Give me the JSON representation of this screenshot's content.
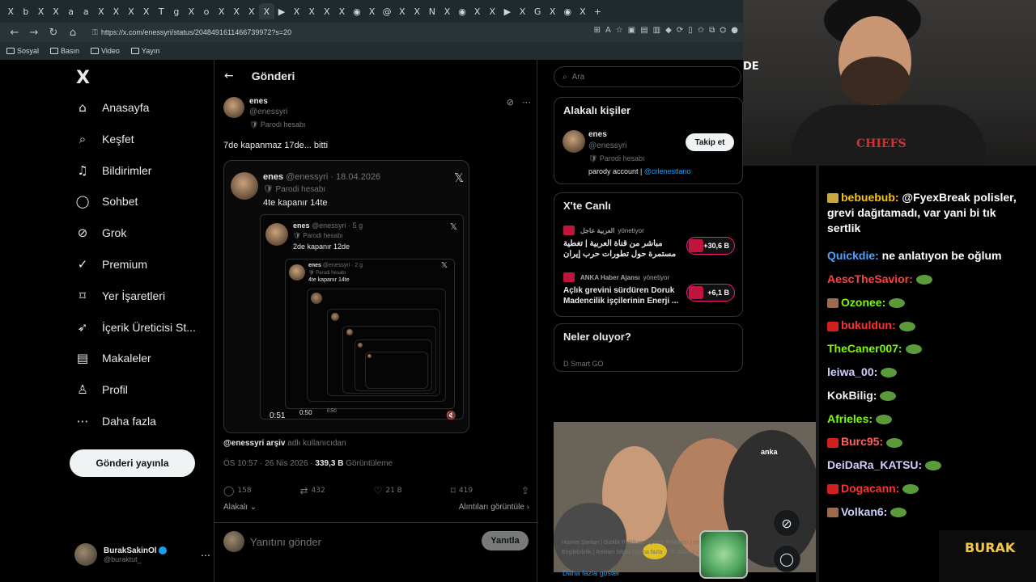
{
  "browser": {
    "tabs": [
      "X",
      "b",
      "X",
      "X",
      "a",
      "a",
      "X",
      "X",
      "X",
      "X",
      "T",
      "g",
      "X",
      "o",
      "X",
      "X",
      "X",
      "X",
      "▶",
      "X",
      "X",
      "X",
      "X",
      "◉",
      "X",
      "@",
      "X",
      "X",
      "N",
      "X",
      "◉",
      "X",
      "X",
      "▶",
      "X",
      "G",
      "X",
      "◉",
      "X",
      "+"
    ],
    "url": "https://x.com/enessyri/status/2048491611466739972?s=20",
    "bookmarks": [
      "Sosyal",
      "Basın",
      "Video",
      "Yayın"
    ]
  },
  "nav": {
    "logo": "X",
    "items": [
      {
        "label": "Anasayfa",
        "icon": "⌂"
      },
      {
        "label": "Keşfet",
        "icon": "⌕"
      },
      {
        "label": "Bildirimler",
        "icon": "♫"
      },
      {
        "label": "Sohbet",
        "icon": "◯"
      },
      {
        "label": "Grok",
        "icon": "⊘"
      },
      {
        "label": "Premium",
        "icon": "✓"
      },
      {
        "label": "Yer İşaretleri",
        "icon": "⌑"
      },
      {
        "label": "İçerik Üreticisi St...",
        "icon": "➶"
      },
      {
        "label": "Makaleler",
        "icon": "▤"
      },
      {
        "label": "Profil",
        "icon": "♙"
      },
      {
        "label": "Daha fazla",
        "icon": "⋯"
      }
    ],
    "post_button": "Gönderi yayınla",
    "account": {
      "name": "BurakSakinOl",
      "handle": "@buraktut_",
      "more": "⋯"
    }
  },
  "post": {
    "header_title": "Gönderi",
    "author": "enes",
    "handle": "@enessyri",
    "parody": "🛡 Parodi hesabı",
    "text": "7de kapanmaz 17de... bitti",
    "embed": {
      "author": "enes",
      "handle_date": "@enessyri · 18.04.2026",
      "parody": "🛡 Parodi hesabı",
      "text": "4te kapanır 14te",
      "nested_author": "enes",
      "nested_meta": "@enessyri · 5 g",
      "nested_parody": "🛡 Parodi hesabı",
      "nested_text": "2de kapanır 12de",
      "deep_author": "enes",
      "deep_meta": "@enessyri · 2 g",
      "deep_parody": "🛡 Parodi hesabı",
      "deep_text": "4te kapanır 14te",
      "time_outer": "0:51",
      "time_inner": "0:50",
      "time_inner2": "0:50"
    },
    "by_user": "@enessyri arşiv",
    "by_suffix": " adlı kullanıcıdan",
    "meta_time": "ÖS 10:57 · 26 Nis 2026 · ",
    "meta_views": "339,3 B",
    "meta_views_label": " Görüntüleme",
    "stats": {
      "replies": "158",
      "reposts": "432",
      "likes": "21 B",
      "bookmarks": "419"
    },
    "related": "Alakalı ⌄",
    "quotes": "Alıntıları görüntüle ›",
    "reply_placeholder": "Yanıtını gönder",
    "reply_button": "Yanıtla"
  },
  "right": {
    "search_placeholder": "Ara",
    "relevant_title": "Alakalı kişiler",
    "relevant": {
      "name": "enes",
      "handle": "@enessyri",
      "parody": "🛡 Parodi hesabı",
      "bio_prefix": "parody account | ",
      "bio_link": "@crlenestlano",
      "follow": "Takip et"
    },
    "live_title": "X'te Canlı",
    "live": [
      {
        "source": "العربية عاجل",
        "role": "yönetiyor",
        "title": "مباشر من قناة العربية | تغطية مستمرة حول تطورات حرب إيران",
        "count": "+30,6 B"
      },
      {
        "source": "ANKA Haber Ajansı",
        "role": "yönetiyor",
        "title": "Açlık grevini sürdüren Doruk Madencilik işçilerinin Enerji ...",
        "count": "+6,1 B"
      }
    ],
    "trends_title": "Neler oluyor?",
    "trends_peek": "D Smart GO",
    "video_watermark": "anka",
    "show_more": "Daha fazla göster",
    "footer": "Hizmet Şartları | Gizlilik Politikası | Çerez Politikası | Imprint | Erişilebilirlik | Reklam bilgisi | Daha fazla ··· © 2026 X Corp."
  },
  "stream": {
    "webcam_text": "DE",
    "chat": [
      {
        "user": "bebuebub:",
        "color": "#f5c518",
        "text": " @FyexBreak polisler, grevi dağıtamadı, var yani bi tık sertlik",
        "badge": "#c8a840"
      },
      {
        "user": "Quickdie:",
        "color": "#4fa3ff",
        "text": " ne anlatıyon be oğlum",
        "badge": ""
      },
      {
        "user": "AescTheSavior:",
        "color": "#ff4040",
        "text": "",
        "badge": "",
        "emote": true
      },
      {
        "user": "Ozonee:",
        "color": "#7cfc00",
        "text": "",
        "badge": "#9b6a4f",
        "emote": true
      },
      {
        "user": "bukuldun:",
        "color": "#ff3030",
        "text": "",
        "badge": "#d02020",
        "emote": true
      },
      {
        "user": "TheCaner007:",
        "color": "#7cfc00",
        "text": "",
        "badge": "",
        "emote": true
      },
      {
        "user": "leiwa_00:",
        "color": "#cfcfff",
        "text": "",
        "badge": "",
        "emote": true
      },
      {
        "user": "KokBilig:",
        "color": "#f0f0f0",
        "text": "",
        "badge": "",
        "emote": true
      },
      {
        "user": "Afrieles:",
        "color": "#7cfc00",
        "text": "",
        "badge": "",
        "emote": true
      },
      {
        "user": "Burc95:",
        "color": "#ff6060",
        "text": "",
        "badge": "#d02020",
        "emote": true
      },
      {
        "user": "DeiDaRa_KATSU:",
        "color": "#cfcfff",
        "text": "",
        "badge": "",
        "emote": true
      },
      {
        "user": "Dogacann:",
        "color": "#ff3030",
        "text": "",
        "badge": "#d02020",
        "emote": true
      },
      {
        "user": "Volkan6:",
        "color": "#cfcfff",
        "text": "",
        "badge": "#9b6a4f",
        "emote": true
      }
    ],
    "logo": "BURAK"
  }
}
